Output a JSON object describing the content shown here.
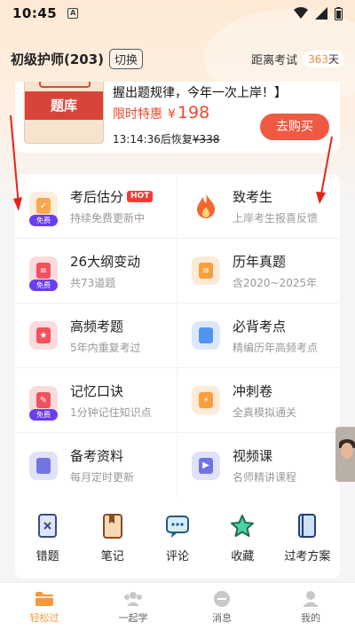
{
  "status_bar": {
    "time": "10:45",
    "notif_letter": "A"
  },
  "header": {
    "exam_title": "初级护师(203)",
    "switch_label": "切换",
    "countdown_label": "距离考试",
    "countdown_days": "363",
    "countdown_suffix": "天"
  },
  "promo": {
    "book_label": "题库",
    "headline": "握出题规律，今年一次上岸！】",
    "price_label": "限时特惠",
    "price_symbol": "¥",
    "price_value": "198",
    "timer": "13:14:36",
    "timer_suffix": "后恢复",
    "original_price": "¥338",
    "buy_label": "去购买"
  },
  "grid": [
    {
      "title": "考后估分",
      "sub": "持续免费更新中",
      "hot": "HOT",
      "free": "免费",
      "icon": "estimate-icon",
      "color": "#f7a64a"
    },
    {
      "title": "致考生",
      "sub": "上岸考生报喜反馈",
      "icon": "flame-icon",
      "color": "#f5672f"
    },
    {
      "title": "26大纲变动",
      "sub": "共73道题",
      "free": "免费",
      "icon": "list-icon",
      "color": "#f04a57"
    },
    {
      "title": "历年真题",
      "sub": "含2020~2025年",
      "icon": "document-icon",
      "color": "#f59b36"
    },
    {
      "title": "高频考题",
      "sub": "5年内重复考过",
      "icon": "star-file-icon",
      "color": "#f04a57"
    },
    {
      "title": "必背考点",
      "sub": "精编历年高频考点",
      "icon": "notes-icon",
      "color": "#4a8ef0"
    },
    {
      "title": "记忆口诀",
      "sub": "1分钟记住知识点",
      "free": "免费",
      "icon": "memo-icon",
      "color": "#f04a57"
    },
    {
      "title": "冲刺卷",
      "sub": "全真模拟通关",
      "icon": "sprint-icon",
      "color": "#f59b36"
    },
    {
      "title": "备考资料",
      "sub": "每月定时更新",
      "icon": "bookmark-icon",
      "color": "#6a6fe0"
    },
    {
      "title": "视频课",
      "sub": "名师精讲课程",
      "icon": "play-icon",
      "color": "#6a6fe0"
    }
  ],
  "quick": [
    {
      "label": "错题",
      "icon": "wrong-questions-icon"
    },
    {
      "label": "笔记",
      "icon": "notebook-icon"
    },
    {
      "label": "评论",
      "icon": "comment-icon"
    },
    {
      "label": "收藏",
      "icon": "star-icon"
    },
    {
      "label": "过考方案",
      "icon": "plan-book-icon"
    }
  ],
  "tabs": [
    {
      "label": "轻松过",
      "active": true,
      "icon": "folder-icon"
    },
    {
      "label": "一起学",
      "icon": "group-icon"
    },
    {
      "label": "消息",
      "icon": "message-icon"
    },
    {
      "label": "我的",
      "icon": "profile-icon"
    }
  ],
  "colors": {
    "accent": "#f59a3b",
    "buy": "#f15a42",
    "price": "#f2472d",
    "annotation": "#e3241c"
  }
}
